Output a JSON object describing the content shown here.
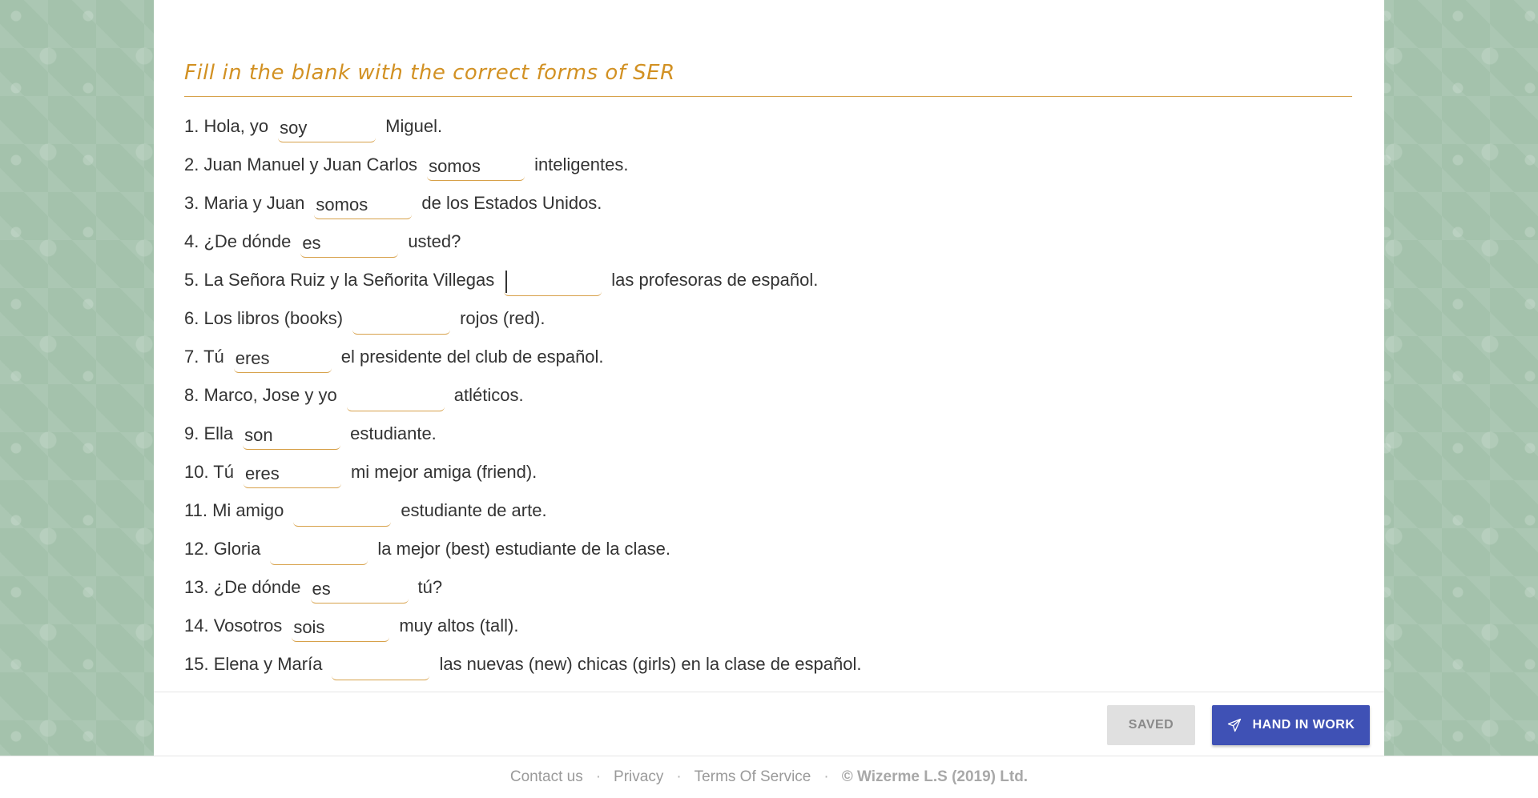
{
  "heading": "Fill in the blank with the correct forms of SER",
  "questions": [
    {
      "prefix": "1. Hola, yo",
      "answer": "soy",
      "suffix": "Miguel."
    },
    {
      "prefix": "2. Juan Manuel y Juan Carlos",
      "answer": "somos",
      "suffix": "inteligentes."
    },
    {
      "prefix": "3. Maria y Juan",
      "answer": "somos",
      "suffix": "de los Estados Unidos."
    },
    {
      "prefix": "4. ¿De dónde",
      "answer": "es",
      "suffix": "usted?"
    },
    {
      "prefix": "5. La Señora Ruiz y la Señorita Villegas",
      "answer": "",
      "suffix": "las profesoras de español."
    },
    {
      "prefix": "6. Los libros (books)",
      "answer": "",
      "suffix": "rojos (red)."
    },
    {
      "prefix": "7. Tú",
      "answer": "eres",
      "suffix": "el presidente del club de español."
    },
    {
      "prefix": "8. Marco, Jose y yo",
      "answer": "",
      "suffix": "atléticos."
    },
    {
      "prefix": "9. Ella",
      "answer": "son",
      "suffix": "estudiante."
    },
    {
      "prefix": "10. Tú",
      "answer": "eres",
      "suffix": "mi mejor amiga (friend)."
    },
    {
      "prefix": "11. Mi amigo",
      "answer": "",
      "suffix": "estudiante de arte."
    },
    {
      "prefix": "12. Gloria",
      "answer": "",
      "suffix": "la mejor (best) estudiante de la clase."
    },
    {
      "prefix": "13. ¿De dónde",
      "answer": "es",
      "suffix": "tú?"
    },
    {
      "prefix": "14. Vosotros",
      "answer": "sois",
      "suffix": "muy altos (tall)."
    },
    {
      "prefix": "15. Elena y María",
      "answer": "",
      "suffix": "las nuevas (new) chicas (girls) en la clase de español."
    }
  ],
  "focused_question": 5,
  "buttons": {
    "saved_label": "SAVED",
    "hand_in_label": "HAND IN WORK",
    "hand_in_icon": "paper-plane-icon"
  },
  "footer": {
    "contact": "Contact us",
    "privacy": "Privacy",
    "terms": "Terms Of Service",
    "separator": "·",
    "copyright": "© Wizerme L.S (2019) Ltd."
  },
  "colors": {
    "background_pattern": "#a4c2ac",
    "heading": "#d29123",
    "accent_line": "#d7a14a",
    "primary_button": "#3f51b5",
    "saved_button": "#e0e0e0"
  }
}
